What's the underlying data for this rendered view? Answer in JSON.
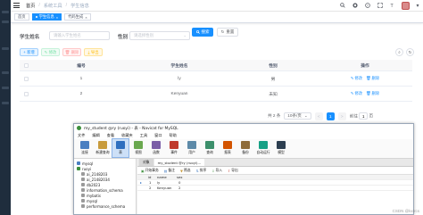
{
  "breadcrumb": [
    "首页",
    "系统工具",
    "学生信息"
  ],
  "tags": [
    {
      "label": "首页",
      "active": false
    },
    {
      "label": "学生信息",
      "active": true
    },
    {
      "label": "代码生成",
      "active": false
    }
  ],
  "search": {
    "name_label": "学生姓名",
    "name_placeholder": "请输入学生姓名",
    "gender_label": "性别",
    "gender_placeholder": "请选择性别",
    "search_button": "搜索",
    "reset_button": "重置"
  },
  "toolbar": {
    "add": "新增",
    "edit": "修改",
    "delete": "删除",
    "export": "导出"
  },
  "table": {
    "columns": [
      "编号",
      "学生姓名",
      "性别",
      "操作"
    ],
    "rows": [
      {
        "id": "1",
        "name": "ly",
        "gender": "男",
        "edit": "修改",
        "delete": "删除"
      },
      {
        "id": "2",
        "name": "Kenyuan",
        "gender": "未知",
        "edit": "修改",
        "delete": "删除"
      }
    ]
  },
  "pagination": {
    "total": "共 2 条",
    "page_size": "10条/页",
    "prev": "<",
    "current": "1",
    "next": ">",
    "goto": "前往",
    "page_input": "1",
    "page_unit": "页"
  },
  "navicat": {
    "title": "my_student @ry (ruoyi) - 表 - Navicat for MySQL",
    "menu": [
      "文件",
      "编辑",
      "查看",
      "收藏夹",
      "工具",
      "窗口",
      "帮助"
    ],
    "ribbon": [
      {
        "label": "连接",
        "color": "#4a7fc1"
      },
      {
        "label": "新建查询",
        "color": "#c89b3c"
      },
      {
        "label": "表",
        "color": "#2f6fbf"
      },
      {
        "label": "视图",
        "color": "#6aa84f"
      },
      {
        "label": "函数",
        "color": "#7b5ea7"
      },
      {
        "label": "事件",
        "color": "#c0392b"
      },
      {
        "label": "用户",
        "color": "#5d8aa8"
      },
      {
        "label": "查询",
        "color": "#3c8f6b"
      },
      {
        "label": "报表",
        "color": "#d35400"
      },
      {
        "label": "备份",
        "color": "#8e6c3a"
      },
      {
        "label": "自动运行",
        "color": "#16a085"
      },
      {
        "label": "模型",
        "color": "#2c3e50"
      }
    ],
    "tree": [
      "mysql",
      "ruoyi",
      "ai_2148203",
      "ai_21482034",
      "db2023",
      "information_schema",
      "mybatis",
      "mysql",
      "performance_schema"
    ],
    "tabs": [
      {
        "label": "对象",
        "active": false
      },
      {
        "label": "my_student @ry (ruoyi)...",
        "active": true
      }
    ],
    "grid_tools": [
      "开始事务",
      "备注",
      "筛选",
      "排序",
      "导入",
      "导出"
    ],
    "grid_columns": [
      "id",
      "name",
      "sex"
    ],
    "grid_rows": [
      {
        "id": "1",
        "name": "ly",
        "sex": "0"
      },
      {
        "id": "2",
        "name": "Kenyuan",
        "sex": "2"
      }
    ]
  },
  "watermark": "CSDN @kxtrcs"
}
